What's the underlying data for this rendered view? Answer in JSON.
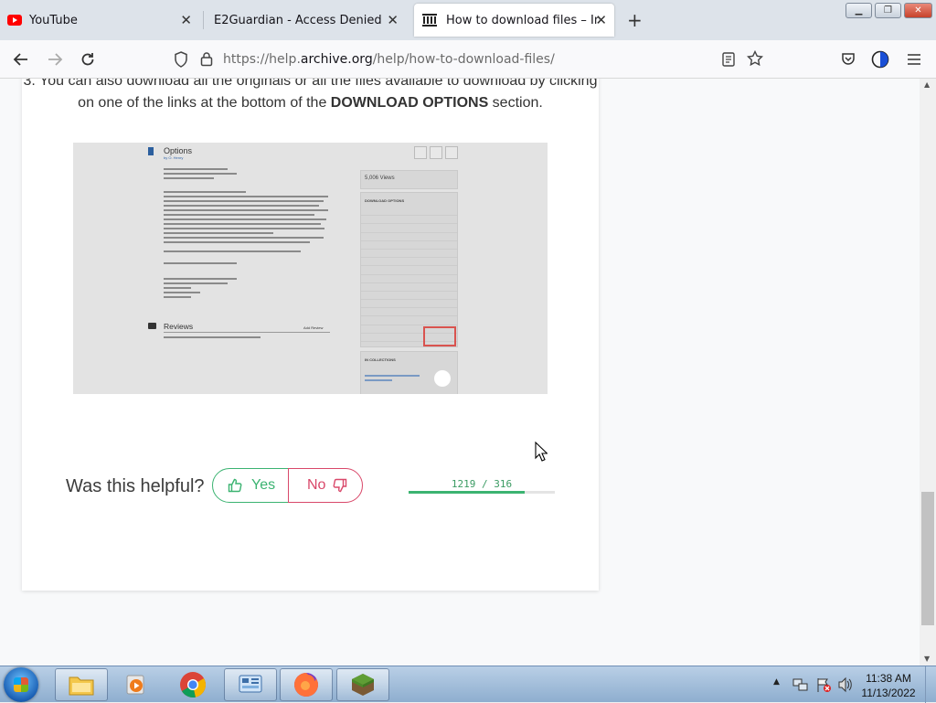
{
  "tabs": [
    {
      "title": "YouTube",
      "icon": "youtube-icon"
    },
    {
      "title": "E2Guardian - Access Denied",
      "icon": ""
    },
    {
      "title": "How to download files – Interne",
      "icon": "archive-icon"
    }
  ],
  "url": {
    "prefix": "https://help.",
    "domain": "archive.org",
    "path": "/help/how-to-download-files/"
  },
  "article": {
    "step_text_pre": "3. You can also download all the originals or all the files available to download by clicking on one of the links at the bottom of the ",
    "step_text_bold": "DOWNLOAD OPTIONS",
    "step_text_post": " section."
  },
  "screenshot_embed": {
    "item_title": "Options",
    "item_by": "by O. Henry",
    "views": "5,006 Views",
    "download_header": "DOWNLOAD OPTIONS",
    "reviews_title": "Reviews",
    "add_review": "Add Review",
    "collections_header": "IN COLLECTIONS"
  },
  "feedback": {
    "question": "Was this helpful?",
    "yes_label": "Yes",
    "no_label": "No",
    "score_text": "1219 / 316",
    "yes_fraction": 0.794,
    "yes_color": "#3bb371",
    "no_color": "#d9486a"
  },
  "taskbar": {
    "time": "11:38 AM",
    "date": "11/13/2022"
  }
}
